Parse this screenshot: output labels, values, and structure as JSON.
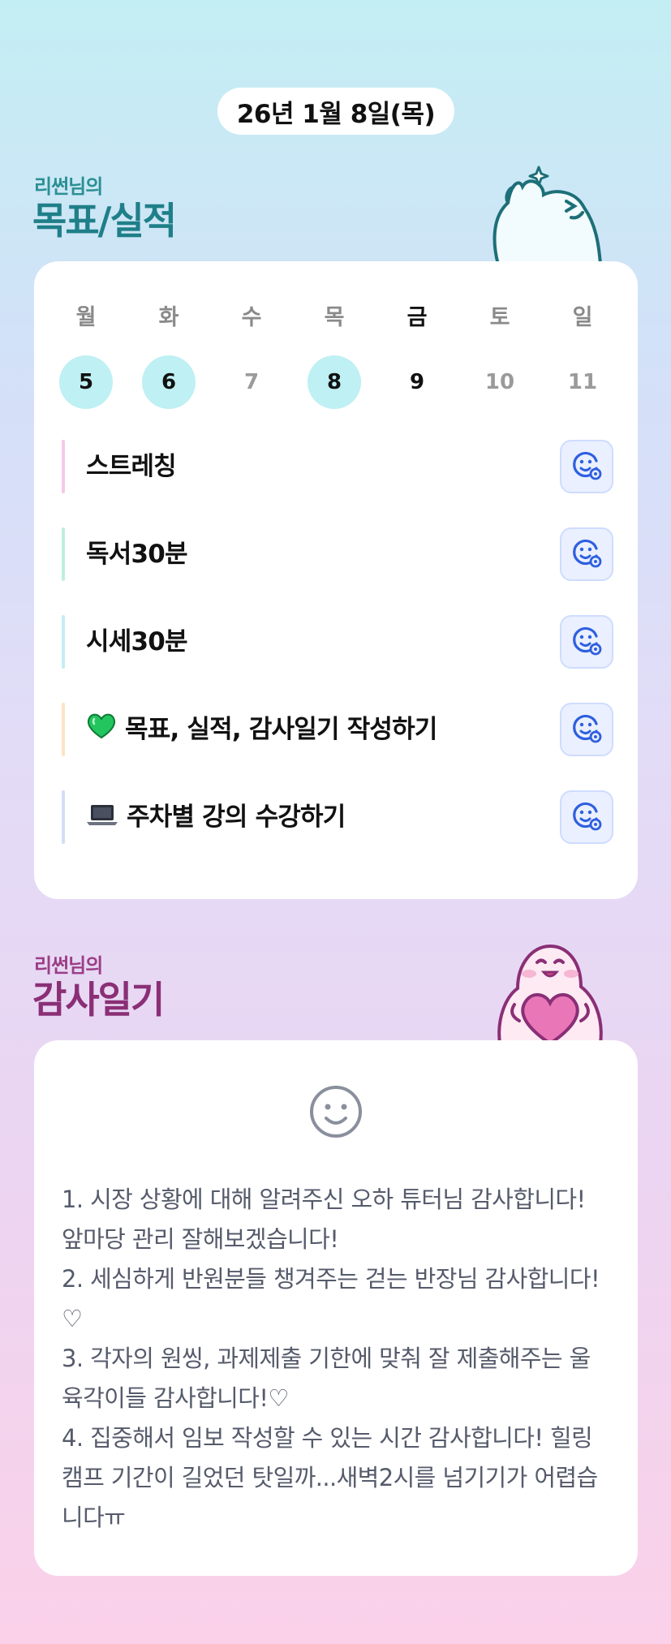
{
  "date": "26년 1월 8일(목)",
  "goals_section": {
    "subtitle": "리썬님의",
    "title": "목표/실적"
  },
  "week": [
    {
      "dow": "월",
      "day": "5",
      "done": true
    },
    {
      "dow": "화",
      "day": "6",
      "done": true
    },
    {
      "dow": "수",
      "day": "7",
      "done": false
    },
    {
      "dow": "목",
      "day": "8",
      "done": true
    },
    {
      "dow": "금",
      "day": "9",
      "done": false
    },
    {
      "dow": "토",
      "day": "10",
      "done": false
    },
    {
      "dow": "일",
      "day": "11",
      "done": false
    }
  ],
  "goals": [
    {
      "label": "스트레칭",
      "color": "#f6c9e6"
    },
    {
      "label": "독서30분",
      "color": "#bfeee0"
    },
    {
      "label": "시세30분",
      "color": "#c3eef3"
    },
    {
      "label": "목표, 실적, 감사일기 작성하기",
      "color": "#fde3c6",
      "icon": "green-heart-icon"
    },
    {
      "label": "주차별 강의 수강하기",
      "color": "#d4ddf7",
      "icon": "laptop-icon"
    }
  ],
  "gratitude_section": {
    "subtitle": "리썬님의",
    "title": "감사일기",
    "text": "1. 시장 상황에 대해 알려주신 오하 튜터님 감사합니다! 앞마당 관리 잘해보겠습니다!\n2. 세심하게 반원분들 챙겨주는 걷는 반장님 감사합니다!♡\n3. 각자의 원씽, 과제제출 기한에 맞춰 잘 제출해주는 울 육각이들 감사합니다!♡\n4. 집중해서 임보 작성할 수 있는 시간 감사합니다! 힐링캠프 기간이 길었던 탓일까...새벽2시를 넘기기가 어렵습니다ㅠ"
  },
  "colors": {
    "teal": "#2a8f93",
    "plum": "#9b3e86",
    "done_circle": "#bff0f3",
    "action_button": "#eaf0ff",
    "action_icon": "#2f5fe0"
  }
}
